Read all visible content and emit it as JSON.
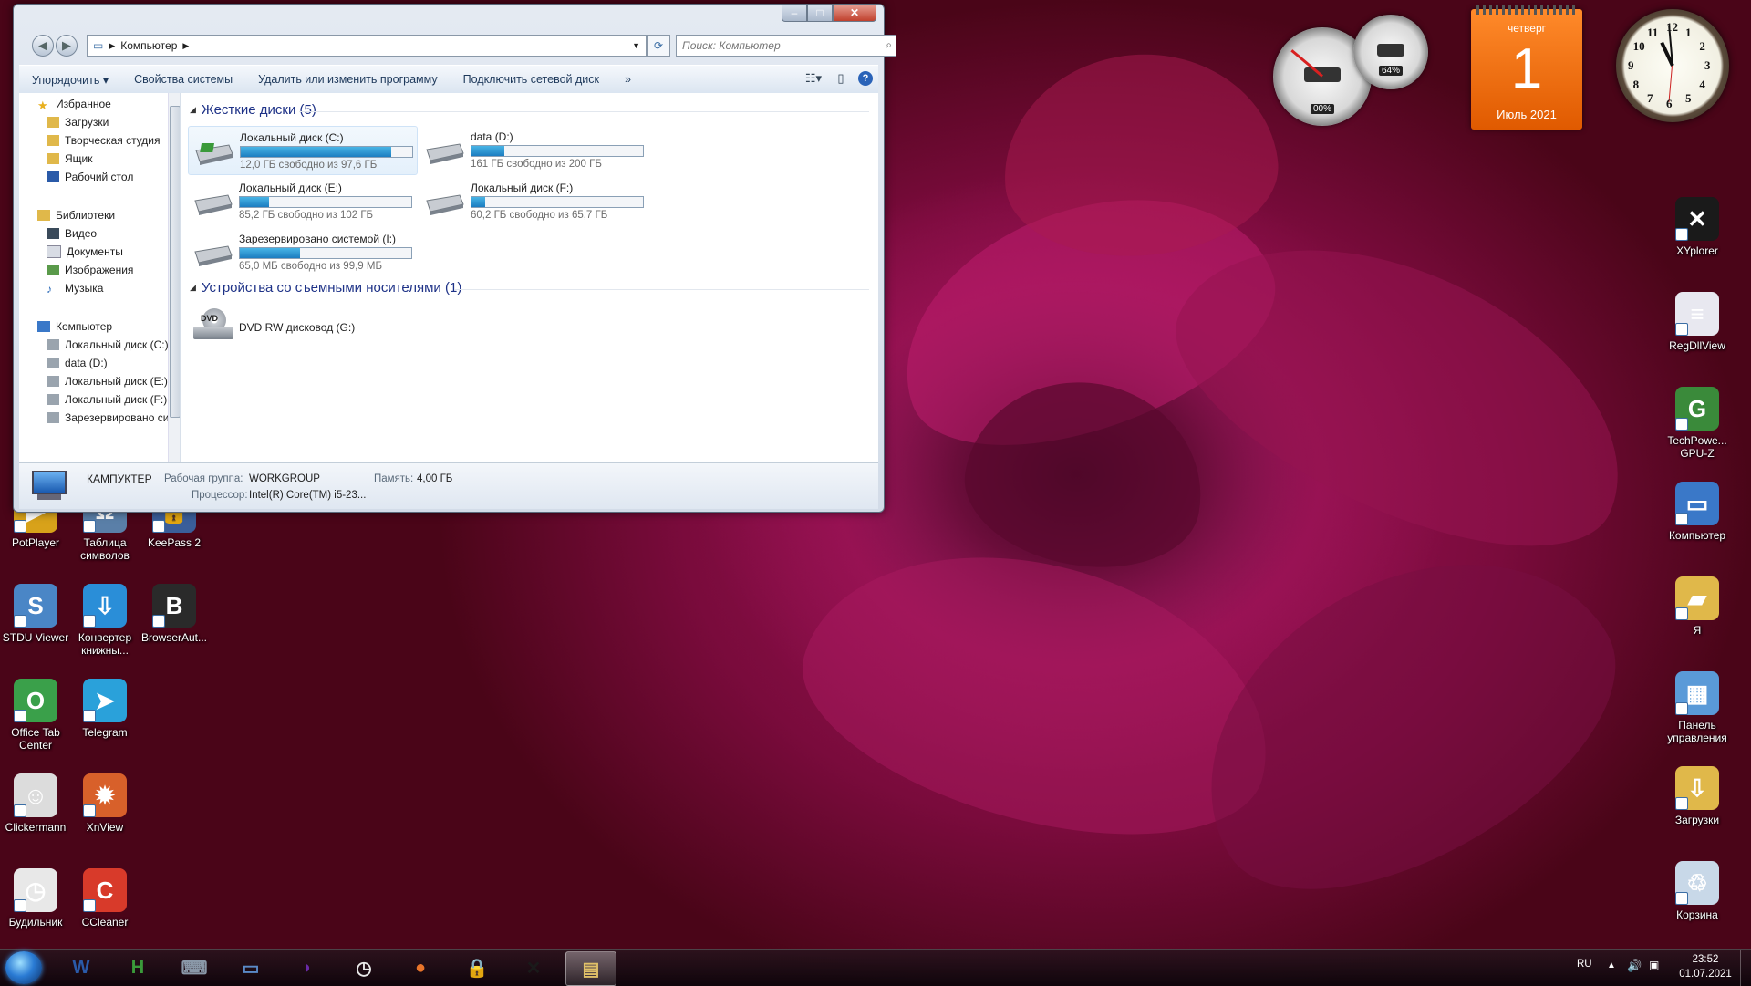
{
  "window": {
    "address_crumb": "Компьютер",
    "search_placeholder": "Поиск: Компьютер",
    "controls": {
      "minimize": "–",
      "maximize": "□",
      "close": "✕"
    },
    "toolbar": [
      "Упорядочить ▾",
      "Свойства системы",
      "Удалить или изменить программу",
      "Подключить сетевой диск",
      "»"
    ],
    "nav": {
      "favorites": {
        "title": "Избранное",
        "items": [
          "Загрузки",
          "Творческая студия",
          "Ящик",
          "Рабочий стол"
        ]
      },
      "libraries": {
        "title": "Библиотеки",
        "items": [
          "Видео",
          "Документы",
          "Изображения",
          "Музыка"
        ]
      },
      "computer": {
        "title": "Компьютер",
        "items": [
          "Локальный диск (C:)",
          "data (D:)",
          "Локальный диск (E:)",
          "Локальный диск (F:)",
          "Зарезервировано системой (I:)"
        ]
      }
    },
    "groups": {
      "hdd": "Жесткие диски (5)",
      "removable": "Устройства со съемными носителями (1)"
    },
    "drives": [
      {
        "name": "Локальный диск (C:)",
        "info": "12,0 ГБ свободно из 97,6 ГБ",
        "used": 0.88
      },
      {
        "name": "data (D:)",
        "info": "161 ГБ свободно из 200 ГБ",
        "used": 0.19
      },
      {
        "name": "Локальный диск (E:)",
        "info": "85,2 ГБ свободно из 102 ГБ",
        "used": 0.17
      },
      {
        "name": "Локальный диск (F:)",
        "info": "60,2 ГБ свободно из 65,7 ГБ",
        "used": 0.08
      },
      {
        "name": "Зарезервировано системой (I:)",
        "info": "65,0 МБ свободно из 99,9 МБ",
        "used": 0.35
      }
    ],
    "dvd": {
      "name": "DVD RW дисковод (G:)",
      "label": "DVD"
    },
    "details": {
      "computer_name": "КАМПУКТЕР",
      "workgroup_label": "Рабочая группа:",
      "workgroup": "WORKGROUP",
      "memory_label": "Память:",
      "memory": "4,00 ГБ",
      "cpu_label": "Процессор:",
      "cpu": "Intel(R) Core(TM) i5-23..."
    }
  },
  "desktop_left": [
    {
      "label": "PotPlayer",
      "color": "#d8a21a",
      "glyph": "▶"
    },
    {
      "label": "Таблица символов",
      "color": "#5a7fa8",
      "glyph": "Ω"
    },
    {
      "label": "KeePass 2",
      "color": "#3a5e9a",
      "glyph": "🔒"
    },
    {
      "label": "STDU Viewer",
      "color": "#4a86c6",
      "glyph": "S"
    },
    {
      "label": "Конвертер книжны...",
      "color": "#2a8ed8",
      "glyph": "⇩"
    },
    {
      "label": "BrowserAut...",
      "color": "#2a2a2a",
      "glyph": "B"
    },
    {
      "label": "Office Tab Center",
      "color": "#3aa04a",
      "glyph": "O"
    },
    {
      "label": "Telegram",
      "color": "#2aa1da",
      "glyph": "➤"
    },
    {
      "label": "Clickermann",
      "color": "#dcdcdc",
      "glyph": "☺"
    },
    {
      "label": "XnView",
      "color": "#d8602a",
      "glyph": "✹"
    },
    {
      "label": "Будильник",
      "color": "#e8e8e8",
      "glyph": "◷"
    },
    {
      "label": "CCleaner",
      "color": "#d83a2a",
      "glyph": "C"
    }
  ],
  "desktop_right": [
    {
      "label": "XYplorer",
      "color": "#1a1a1a",
      "glyph": "✕"
    },
    {
      "label": "RegDllView",
      "color": "#e8e8f0",
      "glyph": "≡"
    },
    {
      "label": "TechPowe... GPU-Z",
      "color": "#3a8a3a",
      "glyph": "G"
    },
    {
      "label": "Компьютер",
      "color": "#3a78c8",
      "glyph": "▭"
    },
    {
      "label": "Я",
      "color": "#e0b84a",
      "glyph": "▰"
    },
    {
      "label": "Панель управления",
      "color": "#5a9ad8",
      "glyph": "▦"
    },
    {
      "label": "Загрузки",
      "color": "#e0b84a",
      "glyph": "⇩"
    },
    {
      "label": "Корзина",
      "color": "#c8d8e8",
      "glyph": "♲"
    }
  ],
  "gadgets": {
    "cpu_gauge": "00%",
    "ram_gauge": "64%",
    "calendar": {
      "weekday": "четверг",
      "day": "1",
      "month_year": "Июль 2021"
    },
    "clock_numbers": [
      "12",
      "1",
      "2",
      "3",
      "4",
      "5",
      "6",
      "7",
      "8",
      "9",
      "10",
      "11"
    ]
  },
  "taskbar": {
    "apps": [
      {
        "name": "word",
        "glyph": "W",
        "color": "#2a5aa8"
      },
      {
        "name": "h-app",
        "glyph": "H",
        "color": "#3a9a3a"
      },
      {
        "name": "keyboard",
        "glyph": "⌨",
        "color": "#8a98a8"
      },
      {
        "name": "computer",
        "glyph": "▭",
        "color": "#5a8ac8"
      },
      {
        "name": "audio",
        "glyph": "◗",
        "color": "#6a2aa8"
      },
      {
        "name": "alarm",
        "glyph": "◷",
        "color": "#e8e8e8"
      },
      {
        "name": "firefox",
        "glyph": "●",
        "color": "#e8742a"
      },
      {
        "name": "keepass",
        "glyph": "🔒",
        "color": "#3a5e9a"
      },
      {
        "name": "xyplorer",
        "glyph": "✕",
        "color": "#1a1a1a"
      },
      {
        "name": "explorer",
        "glyph": "▤",
        "color": "#e0c068"
      }
    ],
    "lang": "RU",
    "time": "23:52",
    "date": "01.07.2021"
  },
  "colors": {
    "accent": "#1e3287",
    "bar_fill": "#26a0da",
    "calendar": "#f07010"
  }
}
